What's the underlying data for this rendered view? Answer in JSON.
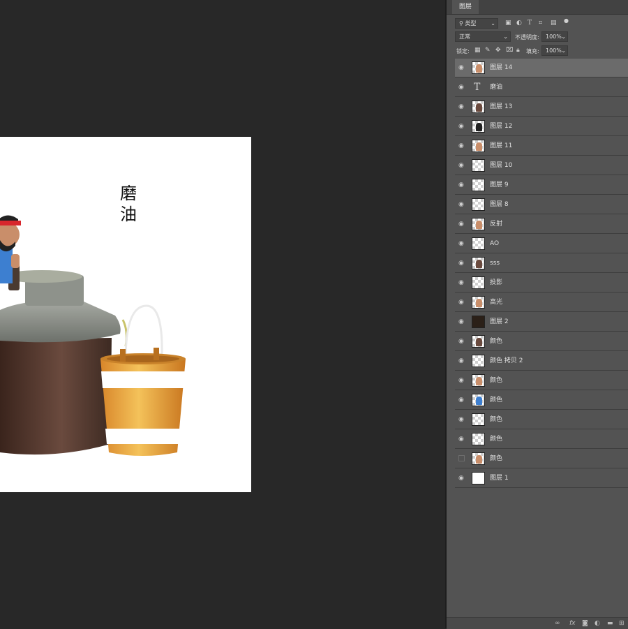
{
  "canvas": {
    "title_chars": [
      "磨",
      "油"
    ]
  },
  "panel": {
    "tab_label": "图层",
    "filter_label": "类型",
    "blend_mode": "正常",
    "opacity_label": "不透明度:",
    "opacity_value": "100%",
    "lock_label": "锁定:",
    "fill_label": "填充:",
    "fill_value": "100%",
    "filter_icons": [
      "image-filter-icon",
      "adjustment-filter-icon",
      "type-filter-icon",
      "shape-filter-icon",
      "smart-object-filter-icon",
      "filter-toggle-icon"
    ],
    "lock_icons": [
      "lock-transparent-icon",
      "lock-paint-icon",
      "lock-position-icon",
      "lock-artboard-icon",
      "lock-all-icon"
    ],
    "footer_icons": [
      "link-layers-icon",
      "fx-icon",
      "add-mask-icon",
      "new-adjustment-icon",
      "new-group-icon",
      "new-layer-icon"
    ]
  },
  "layers": [
    {
      "name": "图层 14",
      "visible": true,
      "selected": true,
      "thumb": "image"
    },
    {
      "name": "磨油",
      "visible": true,
      "thumb": "text"
    },
    {
      "name": "图层 13",
      "visible": true,
      "thumb": "image"
    },
    {
      "name": "图层 12",
      "visible": true,
      "thumb": "image"
    },
    {
      "name": "图层 11",
      "visible": true,
      "thumb": "image"
    },
    {
      "name": "图层 10",
      "visible": true,
      "thumb": "transparent"
    },
    {
      "name": "图层 9",
      "visible": true,
      "thumb": "transparent"
    },
    {
      "name": "图层 8",
      "visible": true,
      "thumb": "transparent"
    },
    {
      "name": "反射",
      "visible": true,
      "thumb": "image"
    },
    {
      "name": "AO",
      "visible": true,
      "thumb": "transparent"
    },
    {
      "name": "sss",
      "visible": true,
      "thumb": "image"
    },
    {
      "name": "投影",
      "visible": true,
      "thumb": "transparent"
    },
    {
      "name": "高光",
      "visible": true,
      "thumb": "image"
    },
    {
      "name": "图层 2",
      "visible": true,
      "thumb": "dark"
    },
    {
      "name": "颜色",
      "visible": true,
      "thumb": "image"
    },
    {
      "name": "颜色 拷贝 2",
      "visible": true,
      "thumb": "transparent"
    },
    {
      "name": "颜色",
      "visible": true,
      "thumb": "image"
    },
    {
      "name": "颜色",
      "visible": true,
      "thumb": "image"
    },
    {
      "name": "颜色",
      "visible": true,
      "thumb": "transparent"
    },
    {
      "name": "颜色",
      "visible": true,
      "thumb": "transparent"
    },
    {
      "name": "颜色",
      "visible": false,
      "thumb": "image"
    },
    {
      "name": "图层 1",
      "visible": true,
      "thumb": "white"
    }
  ],
  "colors": {
    "workspace": "#282828",
    "panel": "#535353",
    "selected_row": "#6b6b6b",
    "bucket": "#e8a33a",
    "headband": "#d8262c",
    "shirt": "#3d7fd0",
    "stone": "#8d918a",
    "vat": "#4a3026"
  }
}
